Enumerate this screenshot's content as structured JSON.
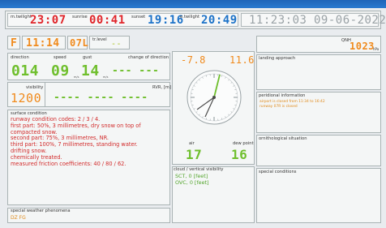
{
  "header": {
    "twilight_morning_label": "m.twilight",
    "twilight_morning_value": "23:07",
    "sunrise_label": "sunrise",
    "sunrise_value": "00:41",
    "sunset_label": "sunset",
    "sunset_value": "19:16",
    "twilight_evening_label": "e.twilight",
    "twilight_evening_value": "20:49",
    "clock": "11:23:03",
    "date": "09-06-2022"
  },
  "runway": {
    "flight_rules": "F",
    "time": "11:14",
    "label_code": "07L",
    "trlevel_label": "tr.level",
    "trlevel_value": "--"
  },
  "qnh": {
    "label": "QNH",
    "value": "1023",
    "unit": "hPa"
  },
  "wind": {
    "direction_label": "direction",
    "direction_value": "014",
    "speed_label": "speed",
    "speed_value": "09",
    "speed_unit": "m/s",
    "gust_label": "gust",
    "gust_value": "14",
    "gust_unit": "m/s",
    "change_label": "change of direction",
    "change_value": "--- ---"
  },
  "temp": {
    "low": "-7.8",
    "high": "11.6"
  },
  "visibility": {
    "label": "visibility",
    "value": "1200",
    "rvr_label": "RVR, [m]",
    "rvr_value": "---- ---- ----"
  },
  "surface": {
    "label": "surface condition",
    "lines": [
      "runway condition codes: 2 / 3 / 4.",
      "first part: 50%, 3 millimetres, dry snow on top of",
      "compacted snow.",
      "second part: 75%, 3 millimetres, NR.",
      "third part: 100%, 7 millimetres, standing water.",
      "drifting snow.",
      "chemically treated.",
      "measured friction coefficients: 40 / 80 / 62."
    ]
  },
  "air": {
    "air_label": "air",
    "air_value": "17",
    "dew_label": "dew point",
    "dew_value": "16"
  },
  "cloud": {
    "label": "cloud / vertical visibility",
    "lines": [
      "SCT, 0 [feet]",
      "OVC, 0 [feet]"
    ]
  },
  "right": {
    "landing_label": "landing approach",
    "info_label": "peridional information",
    "info_lines": [
      "airport is closed from 11:34 to 16:42",
      "runway 07R is closed"
    ],
    "ornitho_label": "ornithological situation",
    "special_label": "special conditions"
  },
  "weather": {
    "label": "special weather phenomena",
    "value": "DZ FG"
  },
  "compass": {
    "wind_direction_deg": 14
  }
}
